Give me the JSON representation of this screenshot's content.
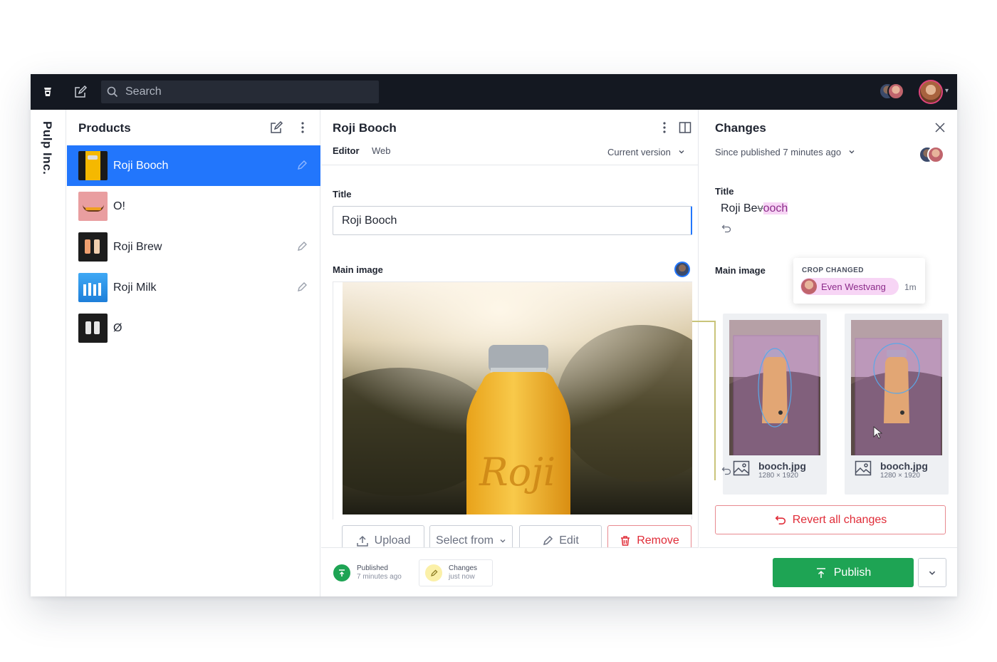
{
  "topbar": {
    "search_placeholder": "Search"
  },
  "workspace": {
    "name": "Pulp Inc."
  },
  "products": {
    "title": "Products",
    "items": [
      {
        "name": "Roji Booch",
        "selected": true,
        "edited": true
      },
      {
        "name": "O!",
        "selected": false,
        "edited": false
      },
      {
        "name": "Roji Brew",
        "selected": false,
        "edited": true
      },
      {
        "name": "Roji Milk",
        "selected": false,
        "edited": true
      },
      {
        "name": "Ø",
        "selected": false,
        "edited": false
      }
    ]
  },
  "editor": {
    "title": "Roji Booch",
    "tabs": [
      {
        "label": "Editor",
        "active": true
      },
      {
        "label": "Web",
        "active": false
      }
    ],
    "version_label": "Current version",
    "fields": {
      "title_label": "Title",
      "title_value": "Roji Booch",
      "main_image_label": "Main image"
    },
    "image_actions": {
      "upload": "Upload",
      "select_from": "Select from",
      "edit": "Edit",
      "remove": "Remove"
    },
    "footer": {
      "published_title": "Published",
      "published_time": "7 minutes ago",
      "changes_title": "Changes",
      "changes_time": "just now"
    }
  },
  "changes": {
    "title": "Changes",
    "since_label": "Since published 7 minutes ago",
    "title_label": "Title",
    "title_diff": {
      "prefix": "Roji Be",
      "deleted": "v",
      "inserted": "ooch"
    },
    "main_image_label": "Main image",
    "images": [
      {
        "filename": "booch.jpg",
        "dims": "1280 × 1920"
      },
      {
        "filename": "booch.jpg",
        "dims": "1280 × 1920"
      }
    ],
    "popover": {
      "label": "CROP CHANGED",
      "user": "Even Westvang",
      "time": "1m"
    },
    "revert_label": "Revert all changes",
    "publish_label": "Publish"
  },
  "colors": {
    "accent": "#2276fc",
    "topbar": "#141821",
    "publish": "#1ea454",
    "danger": "#e02b37",
    "diff_highlight": "#f7d5f5"
  }
}
